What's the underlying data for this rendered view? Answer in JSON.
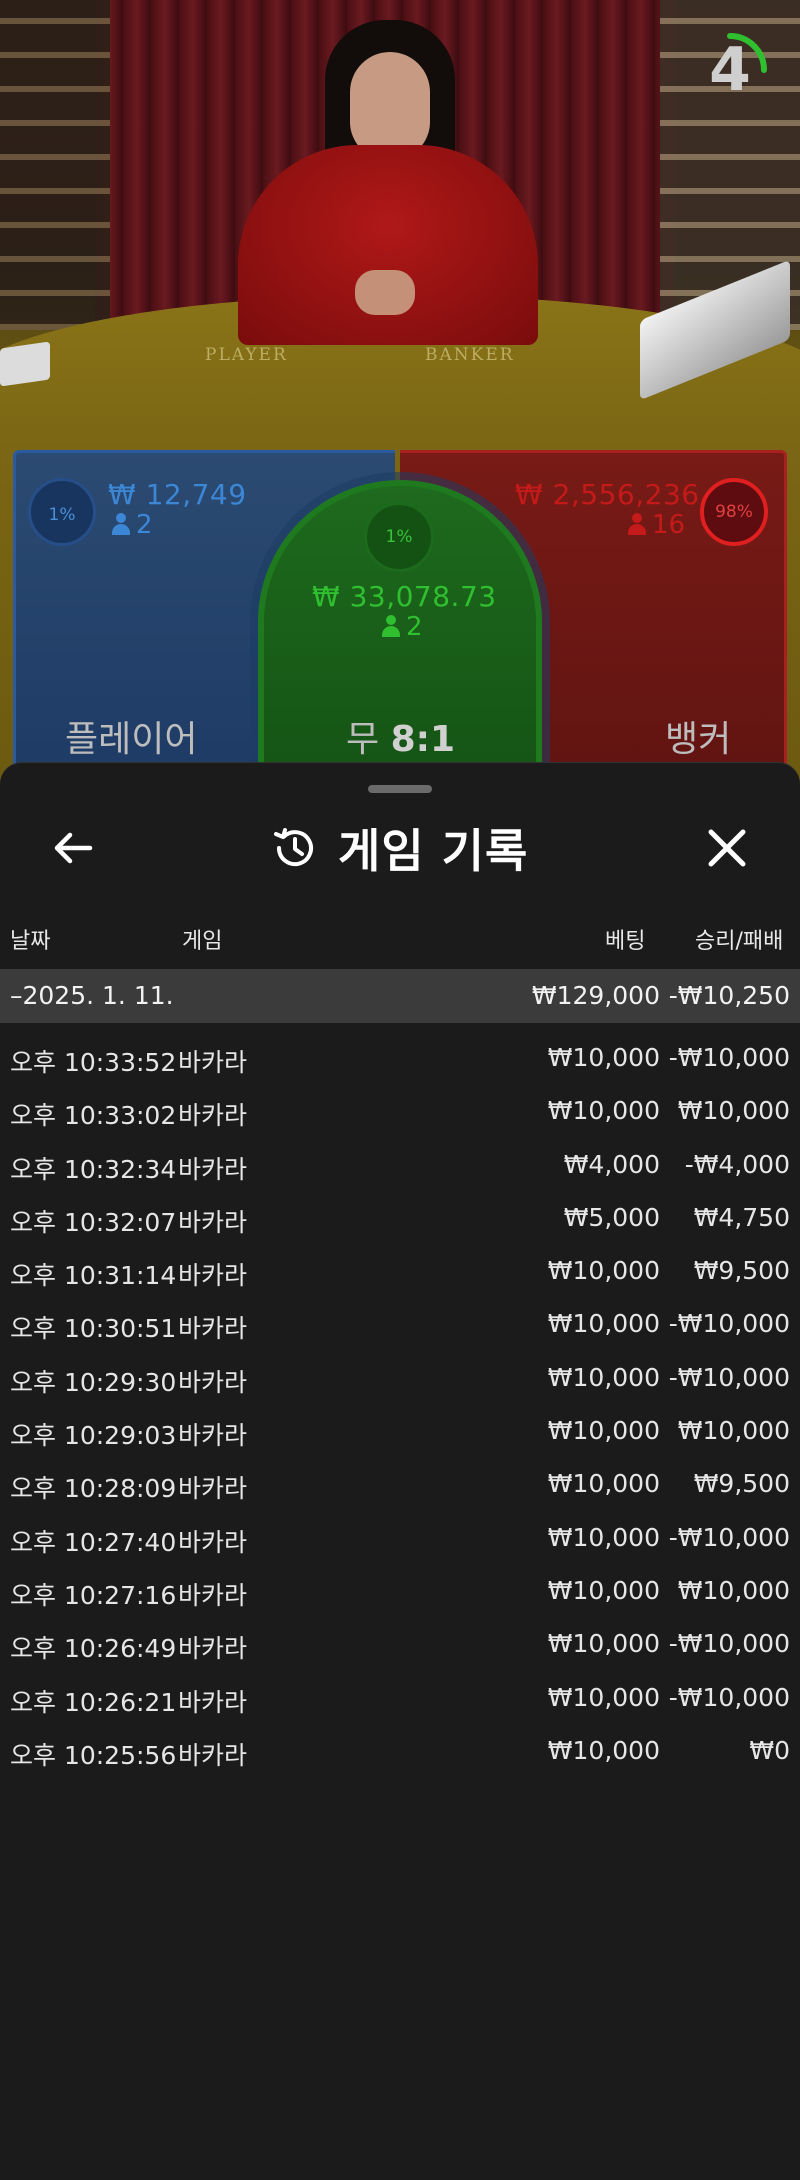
{
  "video": {
    "felt_player_label": "PLAYER",
    "felt_banker_label": "BANKER",
    "countdown": "4"
  },
  "bets": {
    "player": {
      "pct": "1%",
      "amount": "₩ 12,749",
      "count": "2",
      "label": "플레이어",
      "color": "#3c86d6"
    },
    "tie": {
      "pct": "1%",
      "amount": "₩ 33,078.73",
      "count": "2",
      "label_prefix": "무",
      "label_odds": "8:1",
      "color": "#2fbf2f"
    },
    "banker": {
      "pct": "98%",
      "amount": "₩ 2,556,236",
      "count": "16",
      "label": "뱅커",
      "color": "#c41a1a"
    }
  },
  "history": {
    "title": "게임 기록",
    "back_icon": "arrow-left-icon",
    "history_icon": "history-icon",
    "close_icon": "close-icon",
    "columns": {
      "date": "날짜",
      "game": "게임",
      "bet": "베팅",
      "win_loss": "승리/패배"
    },
    "summary": {
      "date": "–2025. 1. 11.",
      "bet": "₩129,000",
      "win_loss": "-₩10,250"
    },
    "rows": [
      {
        "time": "오후 10:33:52",
        "game": "바카라",
        "bet": "₩10,000",
        "win_loss": "-₩10,000"
      },
      {
        "time": "오후 10:33:02",
        "game": "바카라",
        "bet": "₩10,000",
        "win_loss": "₩10,000"
      },
      {
        "time": "오후 10:32:34",
        "game": "바카라",
        "bet": "₩4,000",
        "win_loss": "-₩4,000"
      },
      {
        "time": "오후 10:32:07",
        "game": "바카라",
        "bet": "₩5,000",
        "win_loss": "₩4,750"
      },
      {
        "time": "오후 10:31:14",
        "game": "바카라",
        "bet": "₩10,000",
        "win_loss": "₩9,500"
      },
      {
        "time": "오후 10:30:51",
        "game": "바카라",
        "bet": "₩10,000",
        "win_loss": "-₩10,000"
      },
      {
        "time": "오후 10:29:30",
        "game": "바카라",
        "bet": "₩10,000",
        "win_loss": "-₩10,000"
      },
      {
        "time": "오후 10:29:03",
        "game": "바카라",
        "bet": "₩10,000",
        "win_loss": "₩10,000"
      },
      {
        "time": "오후 10:28:09",
        "game": "바카라",
        "bet": "₩10,000",
        "win_loss": "₩9,500"
      },
      {
        "time": "오후 10:27:40",
        "game": "바카라",
        "bet": "₩10,000",
        "win_loss": "-₩10,000"
      },
      {
        "time": "오후 10:27:16",
        "game": "바카라",
        "bet": "₩10,000",
        "win_loss": "₩10,000"
      },
      {
        "time": "오후 10:26:49",
        "game": "바카라",
        "bet": "₩10,000",
        "win_loss": "-₩10,000"
      },
      {
        "time": "오후 10:26:21",
        "game": "바카라",
        "bet": "₩10,000",
        "win_loss": "-₩10,000"
      },
      {
        "time": "오후 10:25:56",
        "game": "바카라",
        "bet": "₩10,000",
        "win_loss": "₩0"
      }
    ]
  }
}
